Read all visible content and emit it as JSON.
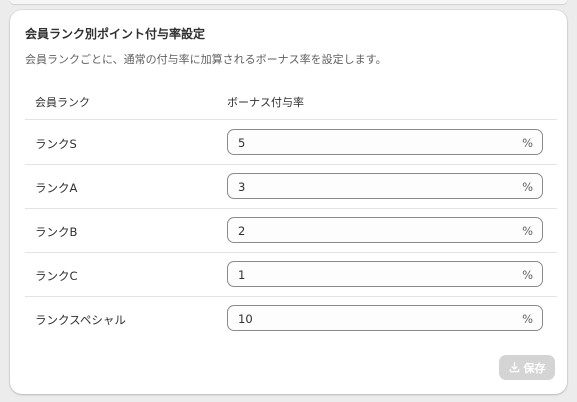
{
  "card": {
    "title": "会員ランク別ポイント付与率設定",
    "description": "会員ランクごとに、通常の付与率に加算されるボーナス率を設定します。"
  },
  "table": {
    "headers": [
      "会員ランク",
      "ボーナス付与率"
    ],
    "rows": [
      {
        "rank": "ランクS",
        "rate": "5",
        "unit": "%"
      },
      {
        "rank": "ランクA",
        "rate": "3",
        "unit": "%"
      },
      {
        "rank": "ランクB",
        "rate": "2",
        "unit": "%"
      },
      {
        "rank": "ランクC",
        "rate": "1",
        "unit": "%"
      },
      {
        "rank": "ランクスペシャル",
        "rate": "10",
        "unit": "%"
      }
    ]
  },
  "actions": {
    "save_label": "保存",
    "save_icon": "download-tray-icon",
    "save_disabled": true
  },
  "colors": {
    "text": "#303030",
    "muted": "#616161",
    "input_border": "#8a8a8a",
    "disabled_button": "#d4d4d4"
  }
}
